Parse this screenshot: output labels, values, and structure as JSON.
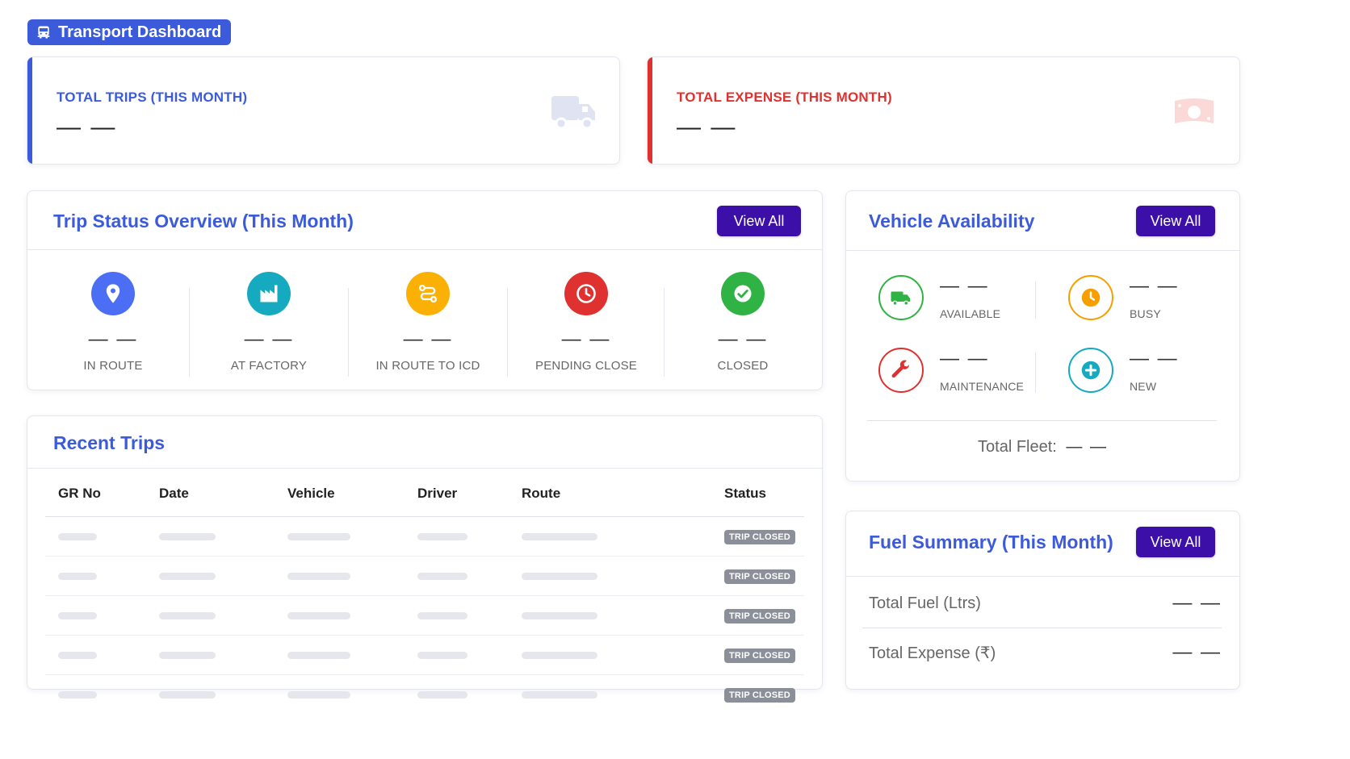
{
  "header": {
    "title": "Transport Dashboard",
    "icon": "bus-icon"
  },
  "kpis": [
    {
      "label": "TOTAL TRIPS (THIS MONTH)",
      "value": "— —",
      "color": "#3b5bdb",
      "icon": "truck-icon"
    },
    {
      "label": "TOTAL EXPENSE (THIS MONTH)",
      "value": "— —",
      "color": "#e03131",
      "icon": "money-icon"
    }
  ],
  "trip_status": {
    "title": "Trip Status Overview (This Month)",
    "view_all": "View All",
    "items": [
      {
        "label": "IN ROUTE",
        "value": "— —",
        "color": "#4c6ef5",
        "icon": "location-pin-icon"
      },
      {
        "label": "AT FACTORY",
        "value": "— —",
        "color": "#15aabf",
        "icon": "factory-icon"
      },
      {
        "label": "IN ROUTE TO ICD",
        "value": "— —",
        "color": "#fab005",
        "icon": "route-icon"
      },
      {
        "label": "PENDING CLOSE",
        "value": "— —",
        "color": "#e03131",
        "icon": "clock-icon"
      },
      {
        "label": "CLOSED",
        "value": "— —",
        "color": "#2fb344",
        "icon": "check-icon"
      }
    ]
  },
  "recent_trips": {
    "title": "Recent Trips",
    "columns": [
      "GR No",
      "Date",
      "Vehicle",
      "Driver",
      "Route",
      "Status"
    ],
    "rows": [
      {
        "status": "TRIP CLOSED"
      },
      {
        "status": "TRIP CLOSED"
      },
      {
        "status": "TRIP CLOSED"
      },
      {
        "status": "TRIP CLOSED"
      },
      {
        "status": "TRIP CLOSED"
      }
    ]
  },
  "vehicle_availability": {
    "title": "Vehicle Availability",
    "view_all": "View All",
    "items": [
      {
        "label": "AVAILABLE",
        "value": "— —",
        "color": "#2fb344",
        "icon": "truck-icon"
      },
      {
        "label": "BUSY",
        "value": "— —",
        "color": "#f59f00",
        "icon": "clock-icon"
      },
      {
        "label": "MAINTENANCE",
        "value": "— —",
        "color": "#e03131",
        "icon": "wrench-icon"
      },
      {
        "label": "NEW",
        "value": "— —",
        "color": "#15aabf",
        "icon": "plus-icon"
      }
    ],
    "total_label": "Total Fleet:",
    "total_value": "— —"
  },
  "fuel_summary": {
    "title": "Fuel Summary (This Month)",
    "view_all": "View All",
    "rows": [
      {
        "label": "Total Fuel (Ltrs)",
        "value": "— —"
      },
      {
        "label": "Total Expense (₹)",
        "value": "— —"
      }
    ]
  }
}
